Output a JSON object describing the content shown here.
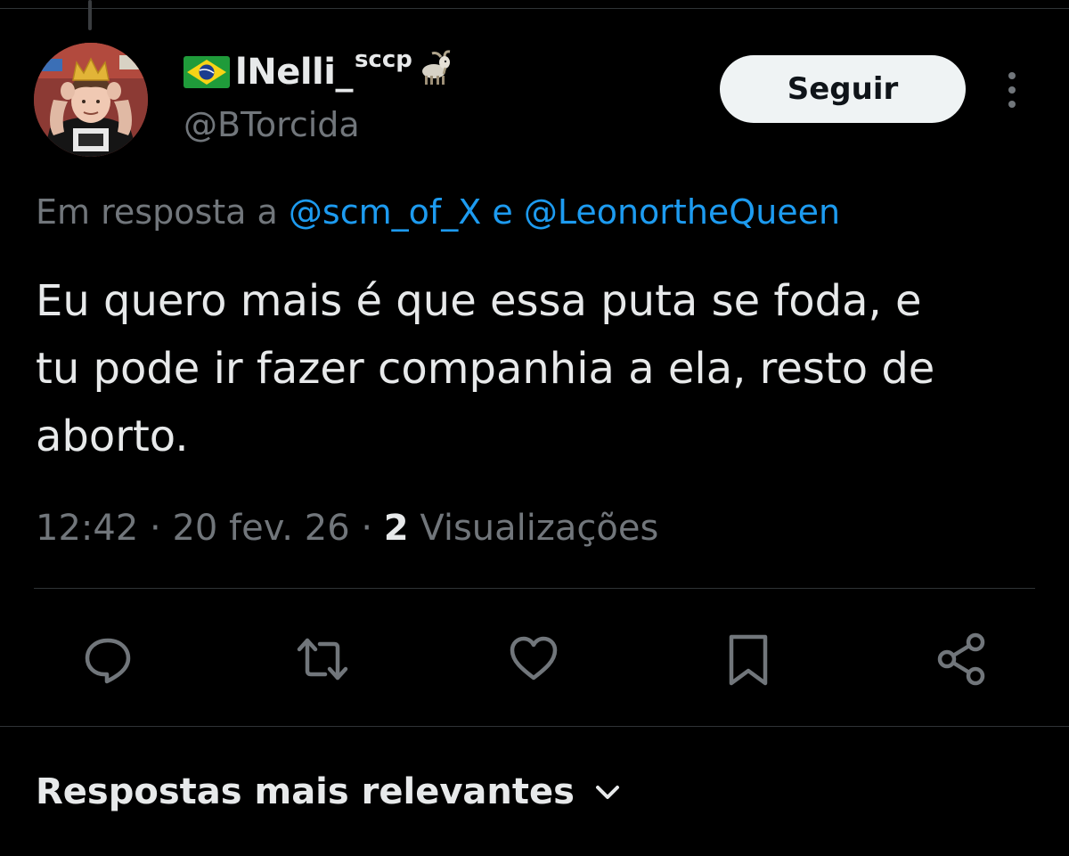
{
  "author": {
    "flag": "🇧🇷",
    "display_name": "lNelli_",
    "name_suffix": "sccp",
    "name_emoji": "goat",
    "handle": "@BTorcida"
  },
  "follow_button": {
    "label": "Seguir"
  },
  "reply_context": {
    "prefix": "Em resposta a",
    "mentions": [
      "@scm_of_X",
      "@LeonortheQueen"
    ],
    "joiner": "e"
  },
  "tweet": {
    "text": "Eu quero mais é que essa puta se foda, e\ntu pode ir fazer companhia a ela, resto de\naborto.",
    "time": "12:42",
    "date": "20 fev. 26",
    "views_count": "2",
    "views_label": "Visualizações"
  },
  "actions": [
    "reply-icon",
    "retweet-icon",
    "like-icon",
    "bookmark-icon",
    "share-icon"
  ],
  "sort": {
    "label": "Respostas mais relevantes"
  },
  "colors": {
    "background": "#000000",
    "text_primary": "#e7e9ea",
    "text_secondary": "#71767b",
    "link": "#1d9bf0",
    "divider": "#2f3336",
    "button_bg": "#eff3f4"
  }
}
